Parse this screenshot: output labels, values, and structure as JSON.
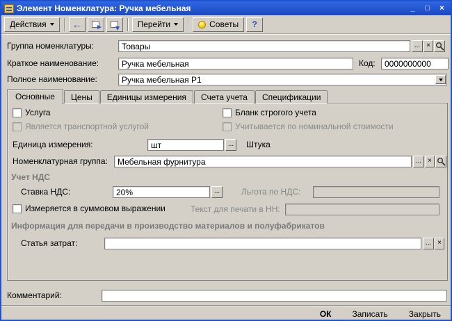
{
  "window": {
    "title": "Элемент Номенклатура: Ручка мебельная",
    "controls": {
      "minimize": "_",
      "maximize": "□",
      "close": "×"
    }
  },
  "toolbar": {
    "actions_label": "Действия",
    "goto_label": "Перейти",
    "tips_label": "Советы",
    "help_label": "?"
  },
  "icons": {
    "ellipsis": "...",
    "clear": "×"
  },
  "fields": {
    "group": {
      "label": "Группа номенклатуры:",
      "value": "Товары"
    },
    "short_name": {
      "label": "Краткое наименование:",
      "value": "Ручка мебельная"
    },
    "code": {
      "label": "Код:",
      "value": "0000000000"
    },
    "full_name": {
      "label": "Полное наименование:",
      "value": "Ручка мебельная Р1"
    }
  },
  "tabs": [
    {
      "label": "Основные",
      "active": true
    },
    {
      "label": "Цены",
      "active": false
    },
    {
      "label": "Единицы измерения",
      "active": false
    },
    {
      "label": "Счета учета",
      "active": false
    },
    {
      "label": "Спецификации",
      "active": false
    }
  ],
  "main": {
    "service_label": "Услуга",
    "strict_label": "Бланк строгого учета",
    "transport_label": "Является транспортной услугой",
    "nominal_label": "Учитывается по номинальной стоимости",
    "unit": {
      "label": "Единица измерения:",
      "value": "шт",
      "hint": "Штука"
    },
    "nom_group": {
      "label": "Номенклатурная группа:",
      "value": "Мебельная фурнитура"
    },
    "vat_section": "Учет НДС",
    "vat_rate": {
      "label": "Ставка НДС:",
      "value": "20%"
    },
    "vat_benefit": {
      "label": "Льгота по НДС:",
      "value": ""
    },
    "sum_label": "Измеряется в суммовом выражении",
    "nn_print": {
      "label": "Текст для печати в НН:",
      "value": ""
    },
    "production_section": "Информация для передачи в производство материалов и полуфабрикатов",
    "cost_item": {
      "label": "Статья затрат:",
      "value": ""
    }
  },
  "comment": {
    "label": "Комментарий:",
    "value": ""
  },
  "footer": {
    "ok": "ОК",
    "save": "Записать",
    "close": "Закрыть"
  }
}
